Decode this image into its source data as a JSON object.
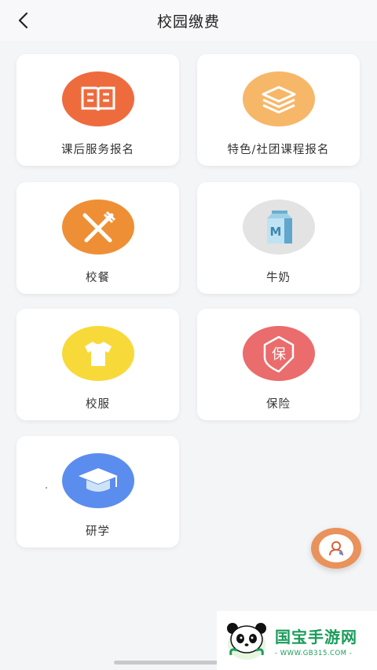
{
  "header": {
    "title": "校园缴费",
    "back_icon": "chevron-left-icon"
  },
  "items": [
    {
      "label": "课后服务报名",
      "icon": "book-icon",
      "color": "#ee6b3e"
    },
    {
      "label": "特色/社团课程报名",
      "icon": "layers-icon",
      "color": "#f7b769"
    },
    {
      "label": "校餐",
      "icon": "fork-knife-icon",
      "color": "#ef8f35"
    },
    {
      "label": "牛奶",
      "icon": "milk-carton-icon",
      "color": "#e3e3e3"
    },
    {
      "label": "校服",
      "icon": "tshirt-icon",
      "color": "#f8d93a"
    },
    {
      "label": "保险",
      "icon": "insurance-icon",
      "color": "#ea6c6c"
    },
    {
      "label": "研学",
      "icon": "graduation-cap-icon",
      "color": "#5b8def"
    }
  ],
  "milk_letter": "M",
  "insurance_char": "保",
  "fab": {
    "icon": "customer-service-icon",
    "color": "#e9925c"
  },
  "watermark": {
    "title": "国宝手游网",
    "url": "- WWW.GB315.COM -"
  }
}
